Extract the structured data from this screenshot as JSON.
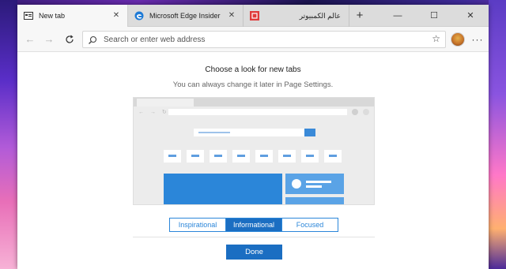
{
  "tabs": [
    {
      "label": "New tab",
      "icon": "new-tab-page-icon",
      "active": true
    },
    {
      "label": "Microsoft Edge Insider",
      "icon": "edge-logo-icon",
      "active": false
    },
    {
      "label": "عالم الكمبيوتر",
      "icon": "site-favicon-icon",
      "active": false
    }
  ],
  "window_controls": {
    "minimize": "—",
    "maximize": "☐",
    "close": "✕"
  },
  "address_bar": {
    "placeholder": "Search or enter web address"
  },
  "content": {
    "title": "Choose a look for new tabs",
    "subtitle": "You can always change it later in Page Settings.",
    "layout_options": [
      "Inspirational",
      "Informational",
      "Focused"
    ],
    "selected_option": "Informational",
    "done_label": "Done"
  },
  "colors": {
    "accent": "#1b6ec2",
    "preview_blue": "#2b86d9",
    "site_favicon": "#e03b3b"
  }
}
